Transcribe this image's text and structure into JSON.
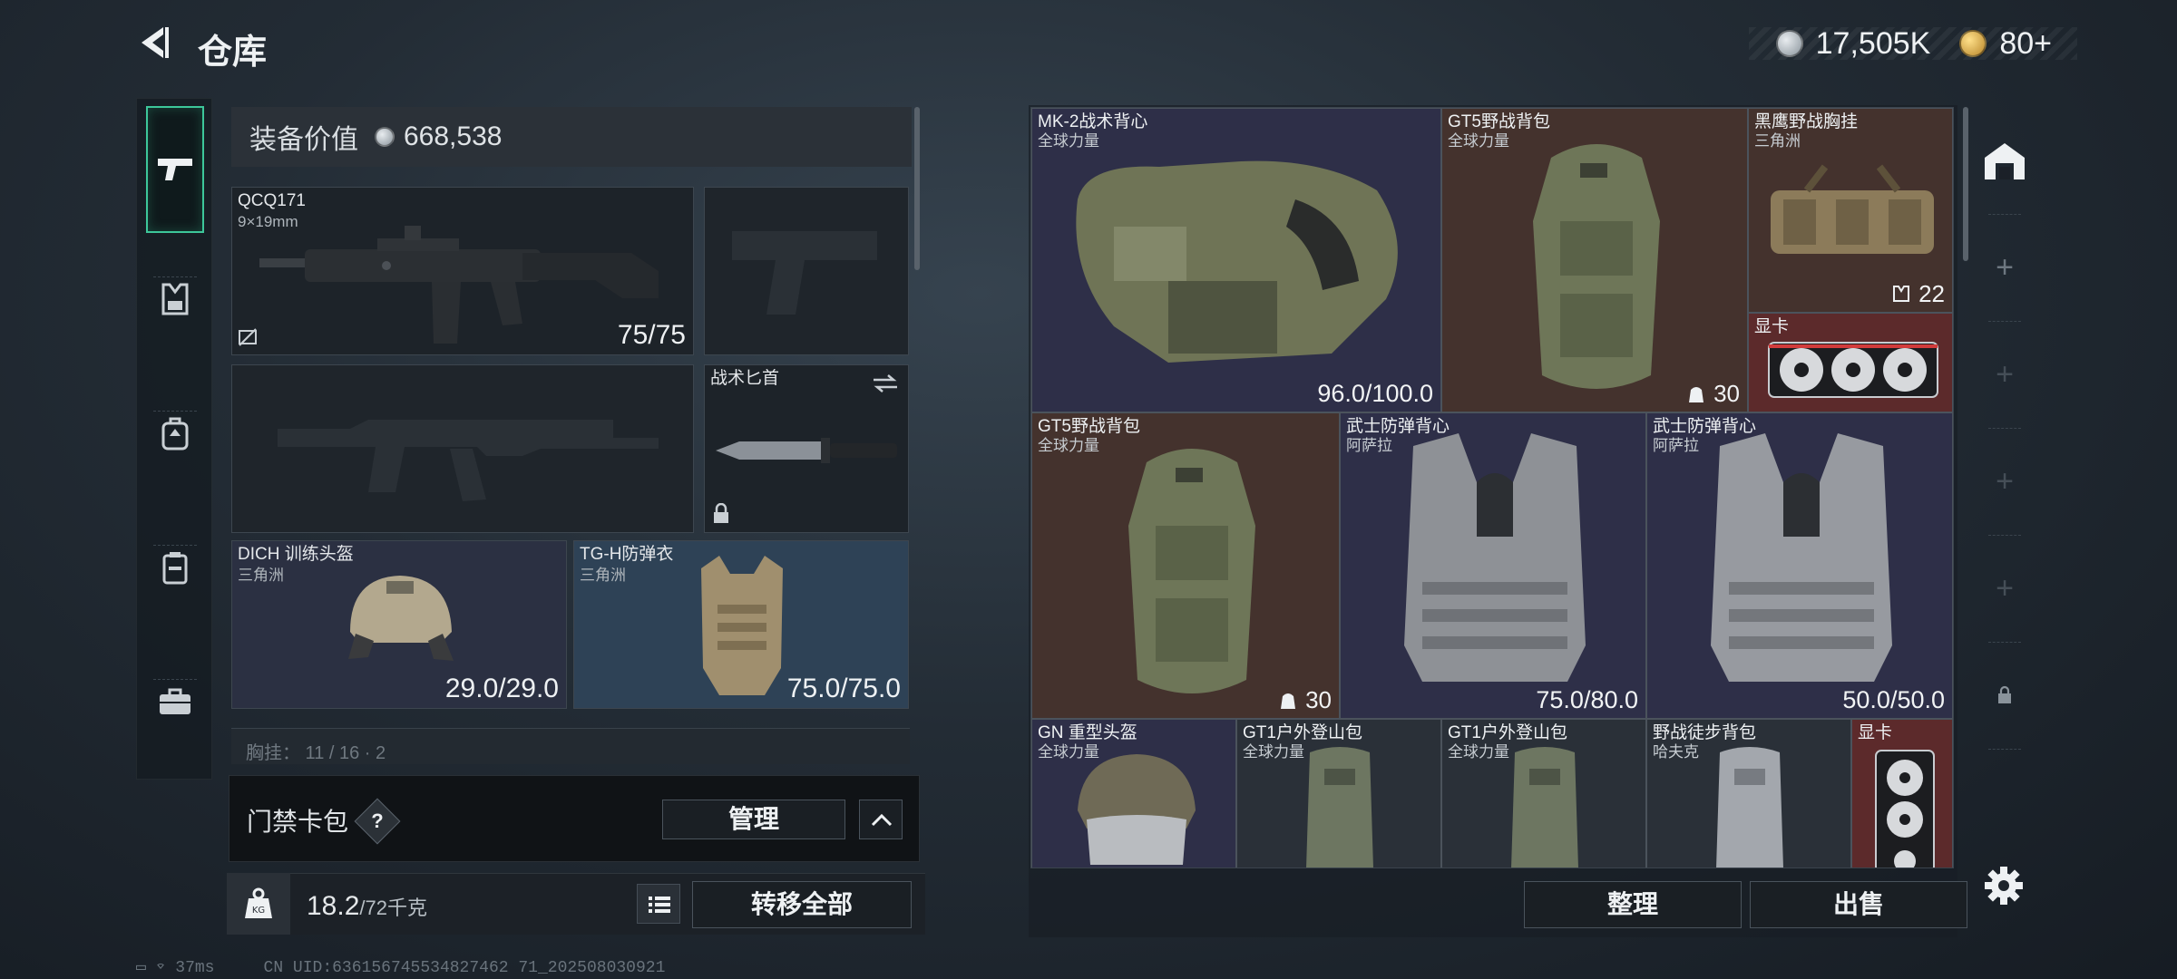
{
  "header": {
    "title": "仓库"
  },
  "currency": {
    "silver": "17,505K",
    "gold": "80+"
  },
  "left_nav": {
    "items": [
      "weapon",
      "chest-rig",
      "backpack",
      "container",
      "briefcase"
    ]
  },
  "equipment": {
    "value_label": "装备价值",
    "value": "668,538",
    "primary": {
      "name": "QCQ171",
      "caliber": "9×19mm",
      "ammo": "75/75"
    },
    "knife": {
      "name": "战术匕首"
    },
    "helmet": {
      "name": "DICH 训练头盔",
      "faction": "三角洲",
      "durability": "29.0/29.0"
    },
    "armor": {
      "name": "TG-H防弹衣",
      "faction": "三角洲",
      "durability": "75.0/75.0"
    },
    "chest_rig_strip": "胸挂： 11 / 16 · 2"
  },
  "card_pack": {
    "label": "门禁卡包",
    "help": "?",
    "manage": "管理"
  },
  "footer_left": {
    "weight": "18.2",
    "weight_unit": "/72千克",
    "transfer_all": "转移全部"
  },
  "status": {
    "ping": "37ms",
    "uid": "CN UID:636156745534827462 71_202508030921"
  },
  "inventory": [
    {
      "name": "MK-2战术背心",
      "sub": "全球力量",
      "value": "96.0/100.0"
    },
    {
      "name": "GT5野战背包",
      "sub": "全球力量",
      "value": "30"
    },
    {
      "name": "黑鹰野战胸挂",
      "sub": "三角洲",
      "value": "22"
    },
    {
      "name": "显卡",
      "sub": "",
      "value": ""
    },
    {
      "name": "GT5野战背包",
      "sub": "全球力量",
      "value": "30"
    },
    {
      "name": "武士防弹背心",
      "sub": "阿萨拉",
      "value": "75.0/80.0"
    },
    {
      "name": "武士防弹背心",
      "sub": "阿萨拉",
      "value": "50.0/50.0"
    },
    {
      "name": "GN 重型头盔",
      "sub": "全球力量",
      "value": ""
    },
    {
      "name": "GT1户外登山包",
      "sub": "全球力量",
      "value": ""
    },
    {
      "name": "GT1户外登山包",
      "sub": "全球力量",
      "value": ""
    },
    {
      "name": "野战徒步背包",
      "sub": "哈夫克",
      "value": ""
    },
    {
      "name": "显卡",
      "sub": "",
      "value": ""
    }
  ],
  "actions": {
    "sort": "整理",
    "sell": "出售"
  },
  "colors": {
    "accent": "#3dc79a",
    "gold_rarity": "#44322d",
    "red_rarity": "#5c2a2b",
    "purple_rarity": "#2e2f48"
  }
}
